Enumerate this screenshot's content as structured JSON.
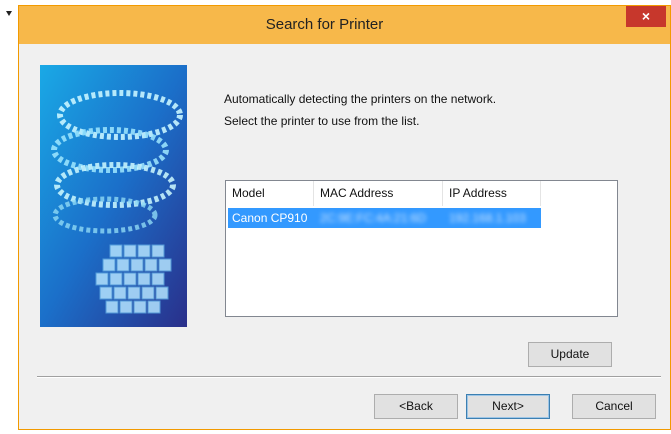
{
  "window": {
    "title": "Search for Printer",
    "close_glyph": "×"
  },
  "intro": {
    "line1": "Automatically detecting the printers on the network.",
    "line2": "Select the printer to use from the list."
  },
  "list": {
    "columns": [
      "Model",
      "MAC Address",
      "IP Address"
    ],
    "rows": [
      {
        "model": "Canon CP910",
        "mac": "2C:9E:FC:4A:21:6D",
        "ip": "192.168.1.103",
        "selected": true
      }
    ]
  },
  "buttons": {
    "update": "Update",
    "back": "<Back",
    "next": "Next>",
    "cancel": "Cancel"
  },
  "colors": {
    "titlebar": "#f7b84a",
    "border": "#f29a00",
    "close": "#c7372c",
    "selection": "#3399ff"
  },
  "icons": {
    "side_image": "canon-printer-banner-icon",
    "close": "close-icon"
  }
}
